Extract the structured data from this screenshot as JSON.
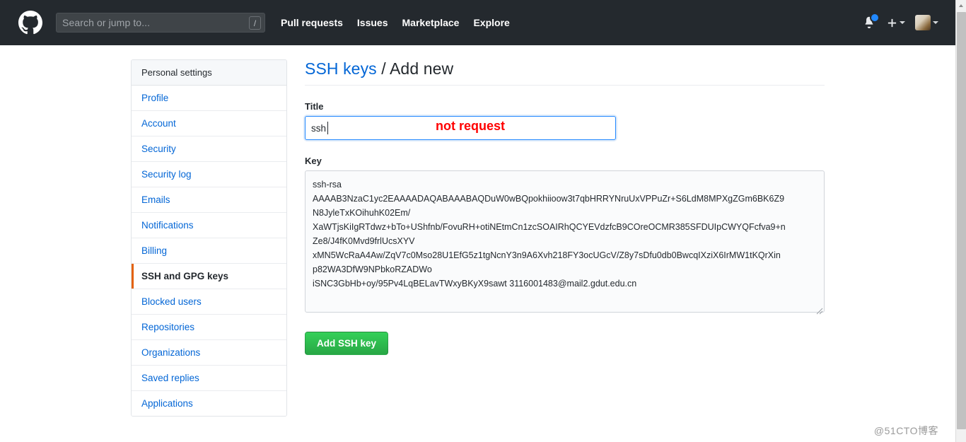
{
  "header": {
    "logo_icon": "github-mark-icon",
    "search": {
      "placeholder": "Search or jump to...",
      "shortcut_key": "/"
    },
    "nav": [
      {
        "label": "Pull requests"
      },
      {
        "label": "Issues"
      },
      {
        "label": "Marketplace"
      },
      {
        "label": "Explore"
      }
    ],
    "notifications_icon": "bell-icon",
    "create_new_icon": "plus-icon",
    "avatar_icon": "user-avatar",
    "background_color": "#24292e"
  },
  "sidebar": {
    "title": "Personal settings",
    "items": [
      {
        "label": "Profile",
        "selected": false
      },
      {
        "label": "Account",
        "selected": false
      },
      {
        "label": "Security",
        "selected": false
      },
      {
        "label": "Security log",
        "selected": false
      },
      {
        "label": "Emails",
        "selected": false
      },
      {
        "label": "Notifications",
        "selected": false
      },
      {
        "label": "Billing",
        "selected": false
      },
      {
        "label": "SSH and GPG keys",
        "selected": true
      },
      {
        "label": "Blocked users",
        "selected": false
      },
      {
        "label": "Repositories",
        "selected": false
      },
      {
        "label": "Organizations",
        "selected": false
      },
      {
        "label": "Saved replies",
        "selected": false
      },
      {
        "label": "Applications",
        "selected": false
      }
    ],
    "selected_accent_color": "#e36209"
  },
  "main": {
    "heading_link": "SSH keys",
    "heading_separator": " / ",
    "heading_current": "Add new",
    "title_field": {
      "label": "Title",
      "value": "ssh",
      "placeholder": ""
    },
    "annotation": {
      "text": "not request",
      "color": "#ff0000"
    },
    "key_field": {
      "label": "Key",
      "value": "ssh-rsa\nAAAAB3NzaC1yc2EAAAADAQABAAABAQDuW0wBQpokhiioow3t7qbHRRYNruUxVPPuZr+S6LdM8MPXgZGm6BK6Z9\nN8JyleTxKOihuhK02Em/\nXaWTjsKiIgRTdwz+bTo+UShfnb/FovuRH+otiNEtmCn1zcSOAIRhQCYEVdzfcB9COreOCMR385SFDUIpCWYQFcfva9+n\nZe8/J4fK0Mvd9frlUcsXYV\nxMN5WcRaA4Aw/ZqV7c0Mso28U1EfG5z1tgNcnY3n9A6Xvh218FY3ocUGcV/Z8y7sDfu0db0BwcqIXziX6IrMW1tKQrXin\np82WA3DfW9NPbkoRZADWo\niSNC3GbHb+oy/95Pv4LqBELavTWxyBKyX9sawt 3116001483@mail2.gdut.edu.cn",
      "placeholder": ""
    },
    "submit_label": "Add SSH key",
    "submit_color": "#28a745"
  },
  "watermark": {
    "text": "@51CTO博客"
  }
}
